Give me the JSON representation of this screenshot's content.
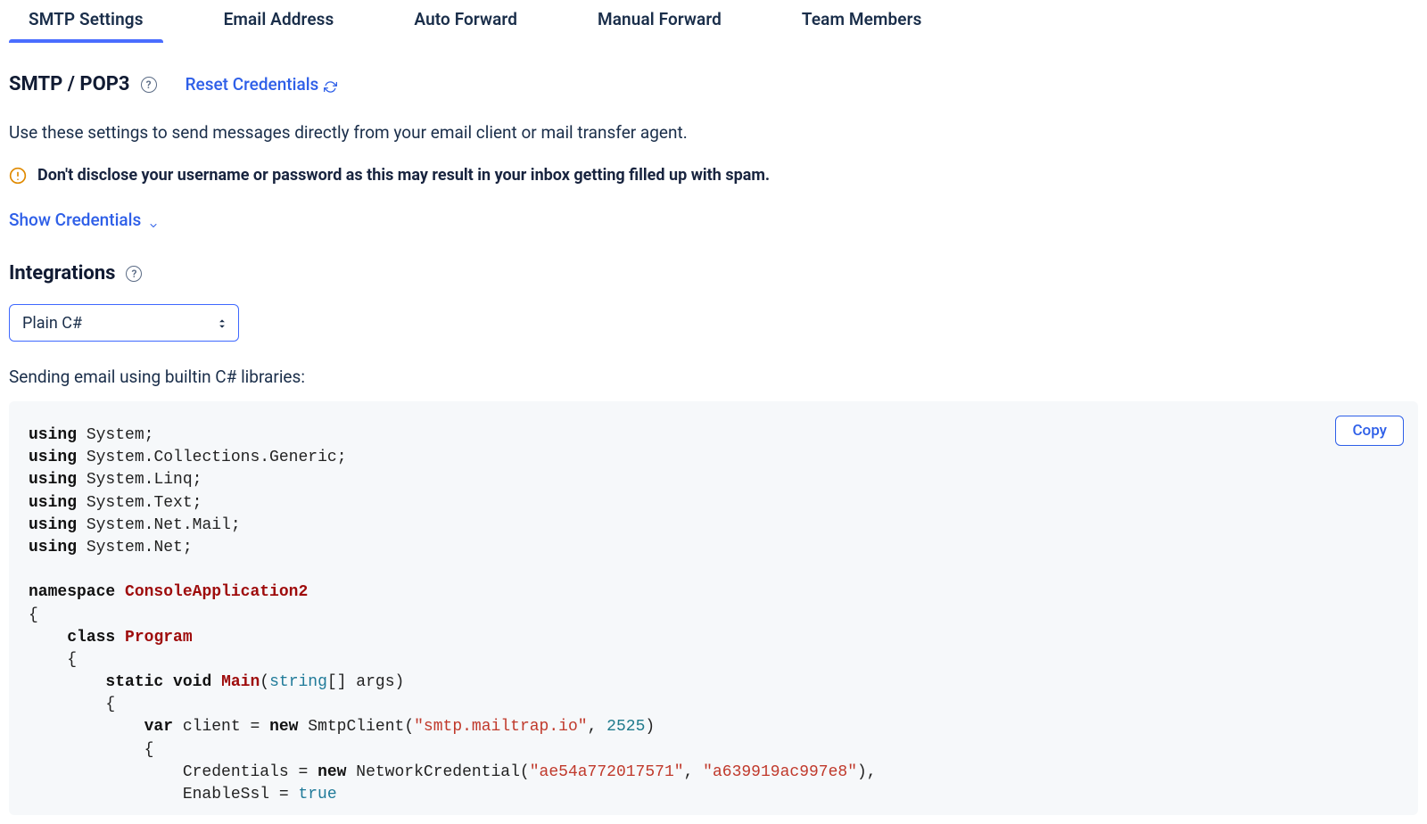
{
  "tabs": [
    {
      "label": "SMTP Settings",
      "active": true
    },
    {
      "label": "Email Address",
      "active": false
    },
    {
      "label": "Auto Forward",
      "active": false
    },
    {
      "label": "Manual Forward",
      "active": false
    },
    {
      "label": "Team Members",
      "active": false
    }
  ],
  "smtp": {
    "title": "SMTP / POP3",
    "reset_label": "Reset Credentials",
    "description": "Use these settings to send messages directly from your email client or mail transfer agent.",
    "warning": "Don't disclose your username or password as this may result in your inbox getting filled up with spam.",
    "show_credentials_label": "Show Credentials"
  },
  "integrations": {
    "title": "Integrations",
    "select_value": "Plain C#",
    "code_description": "Sending email using builtin C# libraries:",
    "copy_label": "Copy",
    "code": {
      "usings": [
        "System",
        "System.Collections.Generic",
        "System.Linq",
        "System.Text",
        "System.Net.Mail",
        "System.Net"
      ],
      "namespace": "ConsoleApplication2",
      "class": "Program",
      "main_signature_prefix": "static void",
      "main_name": "Main",
      "main_param_type": "string",
      "main_param_rest": "[] args",
      "var_decl": "var",
      "client_var": "client",
      "new_kw": "new",
      "smtp_client": "SmtpClient",
      "smtp_host": "\"smtp.mailtrap.io\"",
      "smtp_port": "2525",
      "cred_label": "Credentials",
      "network_cred": "NetworkCredential",
      "cred_user": "\"ae54a772017571\"",
      "cred_pass": "\"a639919ac997e8\"",
      "enable_ssl_label": "EnableSsl",
      "enable_ssl_value": "true"
    }
  }
}
